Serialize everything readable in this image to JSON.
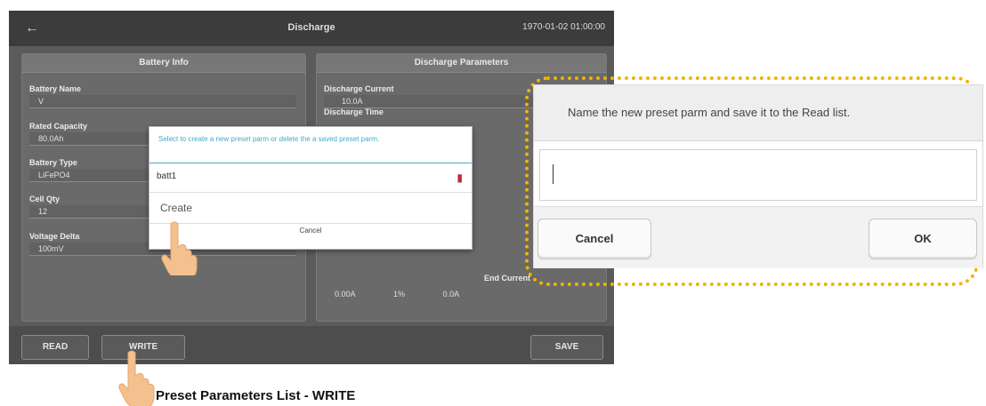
{
  "tablet": {
    "header": {
      "title": "Discharge",
      "datetime": "1970-01-02 01:00:00"
    },
    "battery_info": {
      "title": "Battery Info",
      "battery_name": {
        "label": "Battery Name",
        "value": "V"
      },
      "rated_capacity": {
        "label": "Rated Capacity",
        "value": "80.0Ah"
      },
      "battery_type": {
        "label": "Battery Type",
        "value": "LiFePO4"
      },
      "cell_qty": {
        "label": "Cell Qty",
        "value": "12"
      },
      "voltage_delta": {
        "label": "Voltage Delta",
        "value": "100mV"
      }
    },
    "discharge_params": {
      "title": "Discharge Parameters",
      "discharge_current": {
        "label": "Discharge Current",
        "value": "10.0A"
      },
      "discharge_time": {
        "label": "Discharge Time"
      },
      "end_current_label": "End Current",
      "row_values": [
        "0.00A",
        "1%",
        "0.0A"
      ]
    },
    "buttons": {
      "read": "READ",
      "write": "WRITE",
      "save": "SAVE"
    },
    "popup": {
      "message": "Select to create a new preset parm or delete the a saved preset parm.",
      "item": "batt1",
      "create": "Create",
      "cancel": "Cancel"
    }
  },
  "dialog": {
    "title": "Name the new preset parm and save it to the Read list.",
    "input_value": "",
    "cancel": "Cancel",
    "ok": "OK"
  },
  "caption": "Preset Parameters List - WRITE",
  "colors": {
    "callout": "#f0b400",
    "popup_accent": "#49a7c8",
    "trash": "#c0283b"
  }
}
